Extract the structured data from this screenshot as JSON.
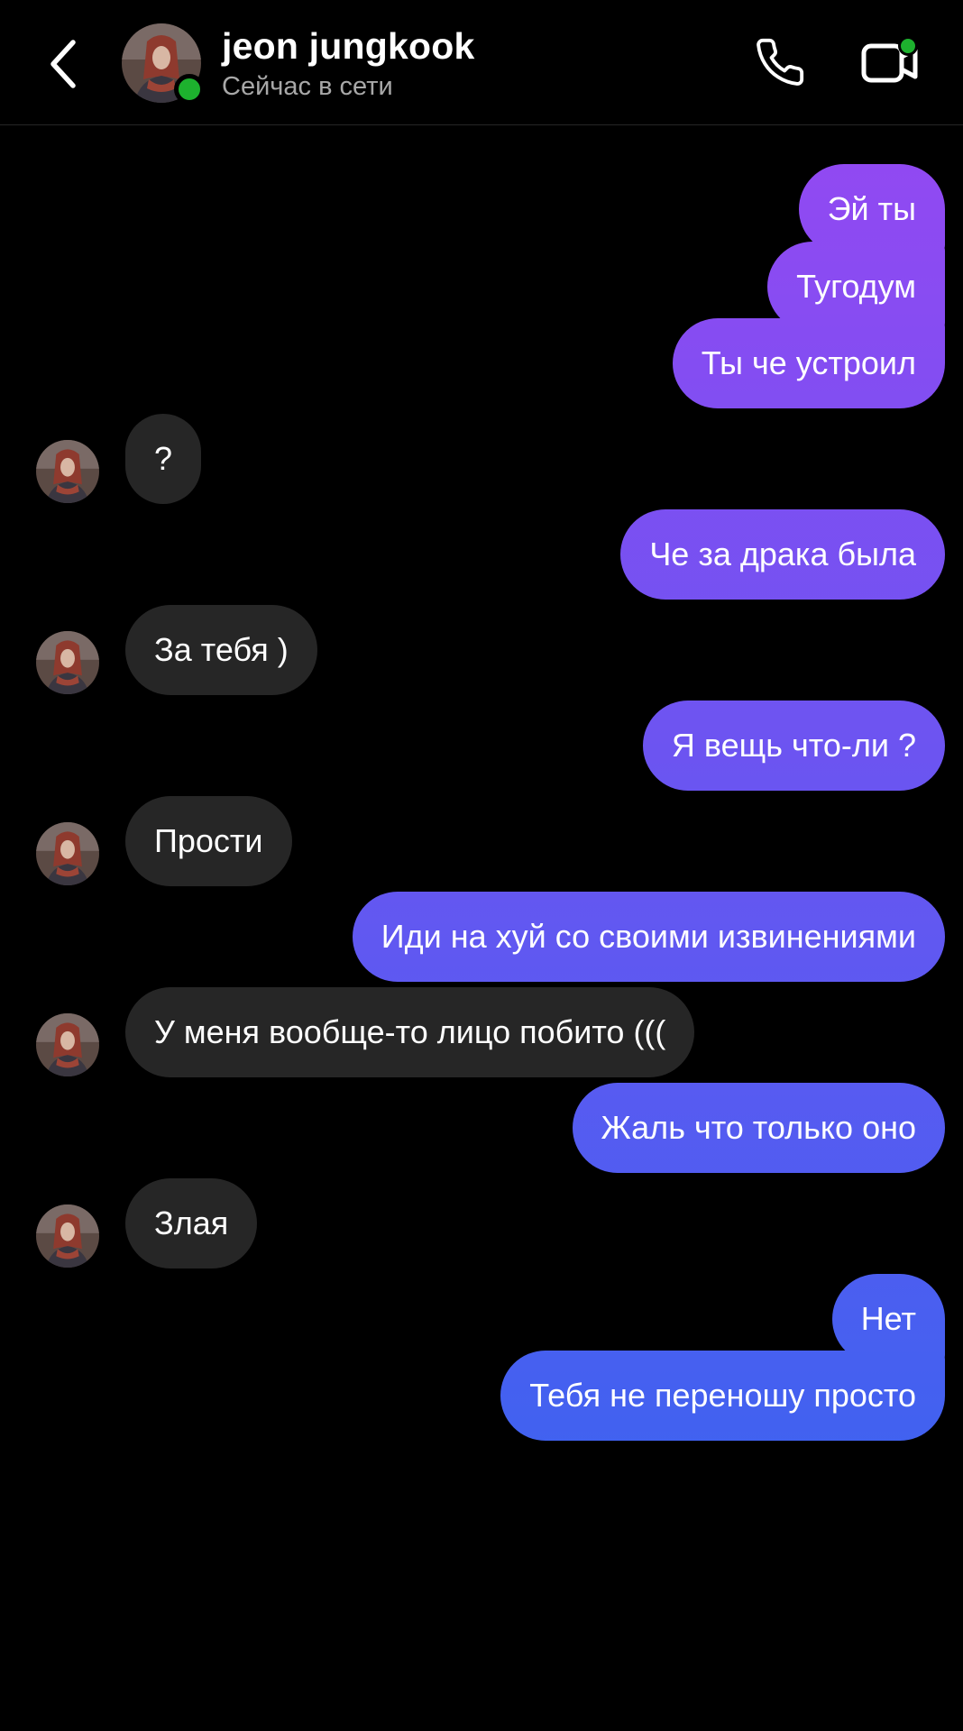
{
  "header": {
    "back_icon": "chevron-left-icon",
    "contact_name": "jeon jungkook",
    "status": "Сейчас в сети",
    "call_icon": "phone-icon",
    "video_icon": "video-camera-icon",
    "online_color": "#1db12e"
  },
  "colors": {
    "background": "#000000",
    "incoming_bubble": "#262626",
    "outgoing_gradient_top": "#9b46f2",
    "outgoing_gradient_bottom": "#2f67f0",
    "status_text": "#a8a8a8"
  },
  "messages": [
    {
      "direction": "out",
      "text": "Эй ты",
      "shape": "first"
    },
    {
      "direction": "out",
      "text": "Тугодум",
      "shape": "middle"
    },
    {
      "direction": "out",
      "text": "Ты че устроил",
      "shape": "last"
    },
    {
      "direction": "in",
      "text": "?"
    },
    {
      "direction": "out",
      "text": "Че за драка была",
      "shape": "single"
    },
    {
      "direction": "in",
      "text": "За тебя )"
    },
    {
      "direction": "out",
      "text": "Я вещь что-ли ?",
      "shape": "single"
    },
    {
      "direction": "in",
      "text": "Прости"
    },
    {
      "direction": "out",
      "text": "Иди на хуй со своими извинениями",
      "shape": "single"
    },
    {
      "direction": "in",
      "text": "У меня вообще-то лицо побито ((("
    },
    {
      "direction": "out",
      "text": "Жаль что только оно",
      "shape": "single"
    },
    {
      "direction": "in",
      "text": "Злая"
    },
    {
      "direction": "out",
      "text": "Нет",
      "shape": "first"
    },
    {
      "direction": "out",
      "text": "Тебя не переношу просто",
      "shape": "last"
    }
  ]
}
